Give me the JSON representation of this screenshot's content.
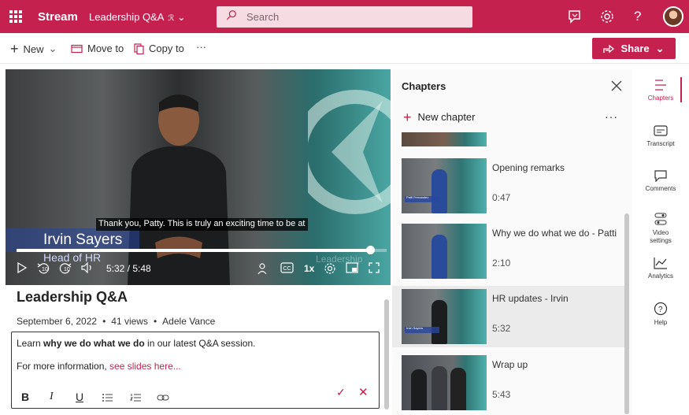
{
  "app": {
    "brand": "Stream",
    "breadcrumb": "Leadership Q&A",
    "search_placeholder": "Search"
  },
  "toolbar": {
    "new_label": "New",
    "move_label": "Move to",
    "copy_label": "Copy to",
    "more_label": "···",
    "share_label": "Share"
  },
  "video": {
    "caption": "Thank you, Patty. This is truly an exciting time to be at",
    "name_overlay": "Irvin Sayers",
    "role_overlay": "Head of HR",
    "watermark": "Leadership",
    "skip_back": "10",
    "skip_fwd": "10",
    "time": "5:32 / 5:48",
    "speed": "1x",
    "progress_fraction": 0.955
  },
  "details": {
    "title": "Leadership Q&A",
    "date": "September 6, 2022",
    "views": "41 views",
    "author": "Adele Vance",
    "desc_prefix": "Learn ",
    "desc_bold": "why we do what we do",
    "desc_suffix": " in our latest Q&A session.",
    "more_info": "For more information, ",
    "link": "see slides here..."
  },
  "chapters": {
    "title": "Chapters",
    "new_chapter": "New chapter",
    "more": "···",
    "items": [
      {
        "name": "Opening remarks",
        "time": "0:47",
        "tag": "Patti Fernandez"
      },
      {
        "name": "Why we do what we do - Patti",
        "time": "2:10"
      },
      {
        "name": "HR updates - Irvin",
        "time": "5:32",
        "tag": "Irvin Sayers"
      },
      {
        "name": "Wrap up",
        "time": "5:43"
      }
    ]
  },
  "rail": {
    "chapters": "Chapters",
    "transcript": "Transcript",
    "comments": "Comments",
    "video_settings_1": "Video",
    "video_settings_2": "settings",
    "analytics": "Analytics",
    "help": "Help"
  },
  "colors": {
    "brand": "#c4214f",
    "link": "#c4214f"
  }
}
